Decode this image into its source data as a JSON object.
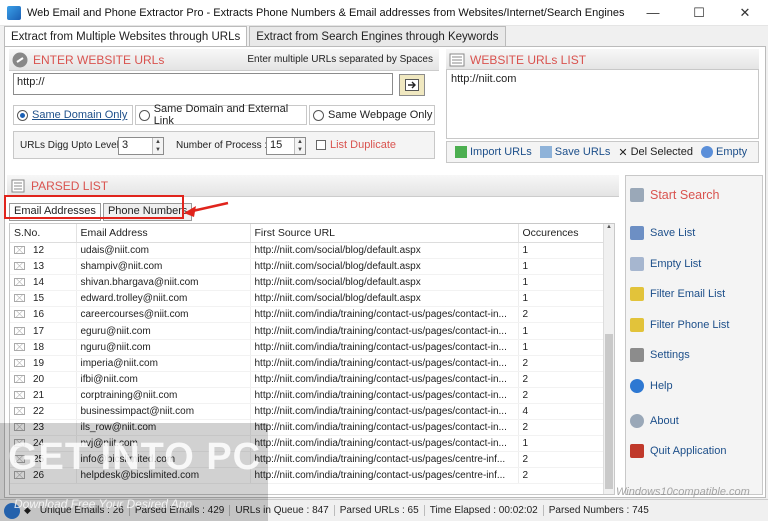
{
  "window": {
    "title": "Web Email and Phone Extractor Pro - Extracts Phone Numbers & Email addresses from Websites/Internet/Search Engines"
  },
  "tabs": [
    "Extract from Multiple Websites through URLs",
    "Extract from Search Engines through Keywords"
  ],
  "enter_urls": {
    "heading": "ENTER WEBSITE URLs",
    "hint": "Enter multiple URLs separated by Spaces",
    "url_value": "http://",
    "options": [
      "Same Domain Only",
      "Same Domain and External Link",
      "Same Webpage Only"
    ],
    "selected_option": "Same Domain Only",
    "digg_label": "URLs Digg Upto Level :",
    "digg_value": "3",
    "process_label": "Number of Process :",
    "process_value": "15",
    "list_duplicate": "List Duplicate"
  },
  "website_list": {
    "heading": "WEBSITE URLs LIST",
    "items": [
      "http://niit.com"
    ],
    "actions": [
      "Import URLs",
      "Save URLs",
      "Del Selected",
      "Empty"
    ]
  },
  "parsed": {
    "heading": "PARSED LIST",
    "subtabs": [
      "Email Addresses",
      "Phone Numbers"
    ],
    "columns": [
      "S.No.",
      "Email Address",
      "First Source URL",
      "Occurences"
    ],
    "rows": [
      [
        "12",
        "udais@niit.com",
        "http://niit.com/social/blog/default.aspx",
        "1"
      ],
      [
        "13",
        "shampiv@niit.com",
        "http://niit.com/social/blog/default.aspx",
        "1"
      ],
      [
        "14",
        "shivan.bhargava@niit.com",
        "http://niit.com/social/blog/default.aspx",
        "1"
      ],
      [
        "15",
        "edward.trolley@niit.com",
        "http://niit.com/social/blog/default.aspx",
        "1"
      ],
      [
        "16",
        "careercourses@niit.com",
        "http://niit.com/india/training/contact-us/pages/contact-in...",
        "2"
      ],
      [
        "17",
        "eguru@niit.com",
        "http://niit.com/india/training/contact-us/pages/contact-in...",
        "1"
      ],
      [
        "18",
        "nguru@niit.com",
        "http://niit.com/india/training/contact-us/pages/contact-in...",
        "1"
      ],
      [
        "19",
        "imperia@niit.com",
        "http://niit.com/india/training/contact-us/pages/contact-in...",
        "2"
      ],
      [
        "20",
        "ifbi@niit.com",
        "http://niit.com/india/training/contact-us/pages/contact-in...",
        "2"
      ],
      [
        "21",
        "corptraining@niit.com",
        "http://niit.com/india/training/contact-us/pages/contact-in...",
        "2"
      ],
      [
        "22",
        "businessimpact@niit.com",
        "http://niit.com/india/training/contact-us/pages/contact-in...",
        "4"
      ],
      [
        "23",
        "ils_row@niit.com",
        "http://niit.com/india/training/contact-us/pages/contact-in...",
        "2"
      ],
      [
        "24",
        "nvj@niit.com",
        "http://niit.com/india/training/contact-us/pages/contact-in...",
        "1"
      ],
      [
        "25",
        "info@bicslimited.com",
        "http://niit.com/india/training/contact-us/pages/centre-inf...",
        "2"
      ],
      [
        "26",
        "helpdesk@bicslimited.com",
        "http://niit.com/india/training/contact-us/pages/centre-inf...",
        "2"
      ]
    ]
  },
  "sidebar": {
    "start": "Start Search",
    "items": [
      "Save List",
      "Empty List",
      "Filter Email List",
      "Filter Phone List",
      "Settings",
      "Help",
      "About",
      "Quit Application"
    ]
  },
  "status": {
    "unique_emails": "Unique Emails : 26",
    "parsed_emails": "Parsed Emails : 429",
    "urls_in_queue": "URLs in Queue : 847",
    "parsed_urls": "Parsed URLs : 65",
    "time_elapsed": "Time Elapsed : 00:02:02",
    "parsed_numbers": "Parsed Numbers : 745"
  },
  "watermark": {
    "main": "GET INTO PC",
    "sub": "Download Free Your Desired App",
    "right": "Windows10compatible.com"
  },
  "colors": {
    "accent_red": "#d9534f",
    "annotation": "#e0241c",
    "link_blue": "#1d4f8a"
  }
}
